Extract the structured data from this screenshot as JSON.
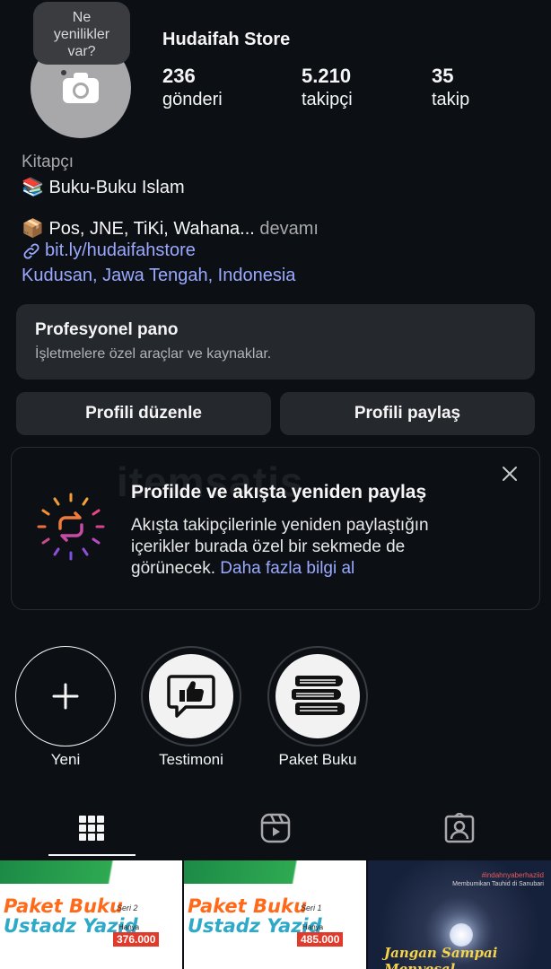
{
  "profile": {
    "tooltip": [
      "Ne",
      "yenilikler",
      "var?"
    ],
    "name": "Hudaifah Store",
    "stats": [
      {
        "value": "236",
        "label": "gönderi"
      },
      {
        "value": "5.210",
        "label": "takipçi"
      },
      {
        "value": "35",
        "label": "takip"
      }
    ],
    "category": "Kitapçı",
    "bio_line1": "📚 Buku-Buku Islam",
    "bio_line2": "📦 Pos, JNE, TiKi, Wahana...",
    "bio_more": " devamı",
    "link": "bit.ly/hudaifahstore",
    "location": "Kudusan, Jawa Tengah, Indonesia"
  },
  "pro_panel": {
    "title": "Profesyonel pano",
    "subtitle": "İşletmelere özel araçlar ve kaynaklar."
  },
  "buttons": {
    "edit": "Profili düzenle",
    "share": "Profili paylaş"
  },
  "repost_card": {
    "title": "Profilde ve akışta yeniden paylaş",
    "desc": "Akışta takipçilerinle yeniden paylaştığın içerikler burada özel bir sekmede de görünecek. ",
    "link": "Daha fazla bilgi al"
  },
  "watermark": "itemsatis",
  "highlights": [
    {
      "label": "Yeni",
      "icon": "plus-icon"
    },
    {
      "label": "Testimoni",
      "icon": "thumbs-up-chat-icon"
    },
    {
      "label": "Paket Buku",
      "icon": "book-stack-icon"
    }
  ],
  "tabs": [
    {
      "icon": "grid-icon",
      "active": true
    },
    {
      "icon": "reels-icon",
      "active": false
    },
    {
      "icon": "tagged-icon",
      "active": false
    }
  ],
  "posts": [
    {
      "title1": "Paket Buku",
      "title2": "Ustadz Yazid",
      "seri": "Seri 2",
      "hanya": "Hanya",
      "price": "376.000"
    },
    {
      "title1": "Paket Buku",
      "title2": "Ustadz Yazid",
      "seri": "Seri 1",
      "hanya": "Hanya",
      "price": "485.000"
    },
    {
      "tag1": "#indahnyaberhaziid",
      "tag2": "Membumikan Tauhid di Sanubari",
      "caption": "Jangan Sampai Menyesal"
    }
  ],
  "colors": {
    "background": "#0c1014",
    "panel": "#25292e",
    "link": "#9aa9ff"
  }
}
